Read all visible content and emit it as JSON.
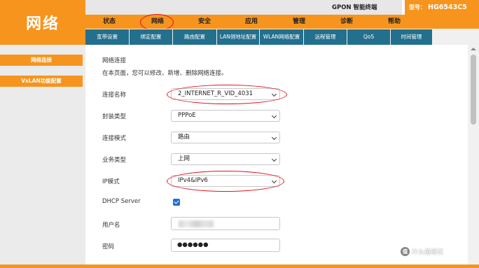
{
  "brand": {
    "title": "网络"
  },
  "topbar": {
    "gpon_text": "GPON 智能终端",
    "model_label": "型号：",
    "model_value": "HG6543C5"
  },
  "main_nav": {
    "items": [
      {
        "label": "状态"
      },
      {
        "label": "网络",
        "active": true
      },
      {
        "label": "安全"
      },
      {
        "label": "应用"
      },
      {
        "label": "管理"
      },
      {
        "label": "诊断"
      },
      {
        "label": "帮助"
      }
    ]
  },
  "sub_nav": {
    "items": [
      {
        "label": "宽带设置"
      },
      {
        "label": "绑定配置"
      },
      {
        "label": "路由配置"
      },
      {
        "label": "LAN侧地址配置"
      },
      {
        "label": "WLAN网络配置"
      },
      {
        "label": "远程管理"
      },
      {
        "label": "QoS"
      },
      {
        "label": "时间管理"
      }
    ]
  },
  "sidebar": {
    "items": [
      {
        "label": "网络连接"
      },
      {
        "label": "VxLAN功能配置"
      }
    ]
  },
  "content": {
    "title": "网络连接",
    "description": "在本页面，您可以修改、新增、删除网络连接。",
    "fields": {
      "connection_name": {
        "label": "连接名称",
        "value": "2_INTERNET_R_VID_4031"
      },
      "encapsulation": {
        "label": "封装类型",
        "value": "PPPoE"
      },
      "connection_mode": {
        "label": "连接模式",
        "value": "路由"
      },
      "service_type": {
        "label": "业务类型",
        "value": "上网"
      },
      "ip_mode": {
        "label": "IP模式",
        "value": "IPv4&IPv6"
      },
      "dhcp_server": {
        "label": "DHCP Server",
        "checked": true
      },
      "username": {
        "label": "用户名"
      },
      "password": {
        "label": "密码",
        "value": "●●●●●●"
      }
    }
  },
  "watermark": {
    "badge": "值",
    "text": "什么值得买"
  },
  "colors": {
    "orange": "#f7941d",
    "teal": "#236f8e",
    "annotation_red": "#e0141e",
    "checkbox_blue": "#1e6fd9"
  }
}
